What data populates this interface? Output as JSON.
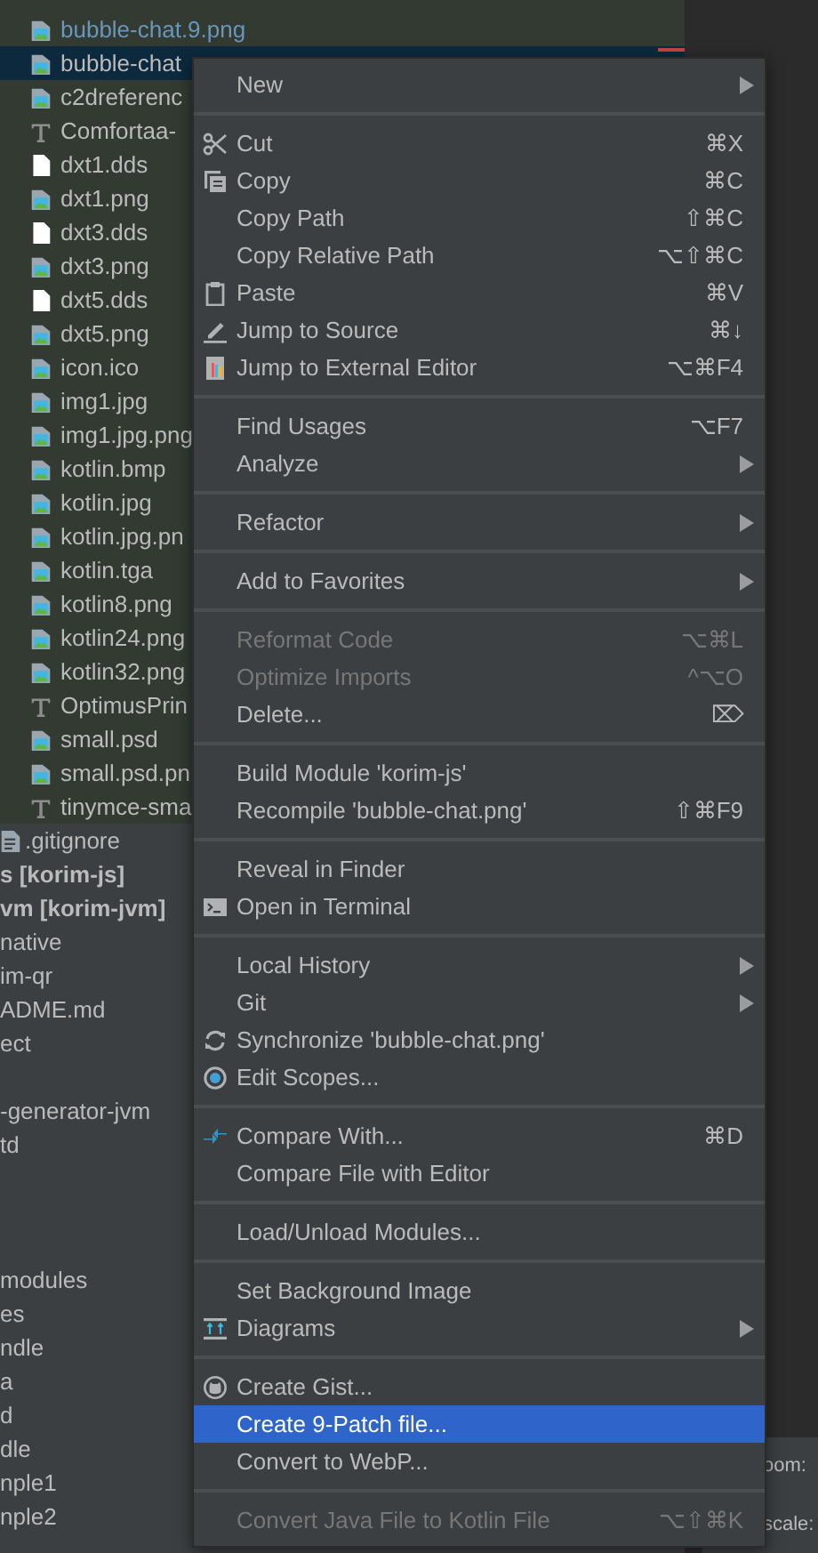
{
  "resource_files": [
    {
      "name": "bubble-chat.9.png",
      "kind": "image",
      "modified": true,
      "selected": false
    },
    {
      "name": "bubble-chat",
      "kind": "image",
      "modified": false,
      "selected": true
    },
    {
      "name": "c2dreferenc",
      "kind": "image",
      "modified": false,
      "selected": false
    },
    {
      "name": "Comfortaa-",
      "kind": "font",
      "modified": false,
      "selected": false
    },
    {
      "name": "dxt1.dds",
      "kind": "file",
      "modified": false,
      "selected": false
    },
    {
      "name": "dxt1.png",
      "kind": "image",
      "modified": false,
      "selected": false
    },
    {
      "name": "dxt3.dds",
      "kind": "file",
      "modified": false,
      "selected": false
    },
    {
      "name": "dxt3.png",
      "kind": "image",
      "modified": false,
      "selected": false
    },
    {
      "name": "dxt5.dds",
      "kind": "file",
      "modified": false,
      "selected": false
    },
    {
      "name": "dxt5.png",
      "kind": "image",
      "modified": false,
      "selected": false
    },
    {
      "name": "icon.ico",
      "kind": "image",
      "modified": false,
      "selected": false
    },
    {
      "name": "img1.jpg",
      "kind": "image",
      "modified": false,
      "selected": false
    },
    {
      "name": "img1.jpg.png",
      "kind": "image",
      "modified": false,
      "selected": false
    },
    {
      "name": "kotlin.bmp",
      "kind": "image",
      "modified": false,
      "selected": false
    },
    {
      "name": "kotlin.jpg",
      "kind": "image",
      "modified": false,
      "selected": false
    },
    {
      "name": "kotlin.jpg.pn",
      "kind": "image",
      "modified": false,
      "selected": false
    },
    {
      "name": "kotlin.tga",
      "kind": "image",
      "modified": false,
      "selected": false
    },
    {
      "name": "kotlin8.png",
      "kind": "image",
      "modified": false,
      "selected": false
    },
    {
      "name": "kotlin24.png",
      "kind": "image",
      "modified": false,
      "selected": false
    },
    {
      "name": "kotlin32.png",
      "kind": "image",
      "modified": false,
      "selected": false
    },
    {
      "name": "OptimusPrin",
      "kind": "font",
      "modified": false,
      "selected": false
    },
    {
      "name": "small.psd",
      "kind": "image",
      "modified": false,
      "selected": false
    },
    {
      "name": "small.psd.pn",
      "kind": "image",
      "modified": false,
      "selected": false
    },
    {
      "name": "tinymce-sma",
      "kind": "font",
      "modified": false,
      "selected": false
    }
  ],
  "project_tree": [
    {
      "items": [
        {
          "name": ".gitignore",
          "kind": "text",
          "bold": false
        },
        {
          "name": "s [korim-js]",
          "kind": "plain",
          "bold": true
        },
        {
          "name": "vm [korim-jvm]",
          "kind": "plain",
          "bold": true
        },
        {
          "name": "native",
          "kind": "plain",
          "bold": false
        },
        {
          "name": "im-qr",
          "kind": "plain",
          "bold": false
        },
        {
          "name": "ADME.md",
          "kind": "plain",
          "bold": false
        },
        {
          "name": "ect",
          "kind": "plain",
          "bold": false
        }
      ]
    },
    {
      "items": [
        {
          "name": "-generator-jvm",
          "kind": "plain",
          "bold": false
        },
        {
          "name": "td",
          "kind": "plain",
          "bold": false
        }
      ]
    },
    {
      "items": [
        {
          "name": "modules",
          "kind": "plain",
          "bold": false
        },
        {
          "name": "es",
          "kind": "plain",
          "bold": false
        },
        {
          "name": "ndle",
          "kind": "plain",
          "bold": false
        },
        {
          "name": "a",
          "kind": "plain",
          "bold": false
        },
        {
          "name": "d",
          "kind": "plain",
          "bold": false
        },
        {
          "name": "dle",
          "kind": "plain",
          "bold": false
        },
        {
          "name": "nple1",
          "kind": "plain",
          "bold": false
        },
        {
          "name": "nple2",
          "kind": "plain",
          "bold": false
        }
      ]
    }
  ],
  "side_panel": [
    "oom:",
    "scale:"
  ],
  "context_menu": [
    [
      {
        "label": "New",
        "submenu": true,
        "disabled": false,
        "selected": false
      }
    ],
    [
      {
        "label": "Cut",
        "kind": "scissors",
        "shortcut": "⌘X",
        "submenu": false,
        "disabled": false,
        "selected": false
      },
      {
        "label": "Copy",
        "kind": "copy",
        "shortcut": "⌘C",
        "submenu": false,
        "disabled": false,
        "selected": false
      },
      {
        "label": "Copy Path",
        "shortcut": "⇧⌘C",
        "submenu": false,
        "disabled": false,
        "selected": false
      },
      {
        "label": "Copy Relative Path",
        "shortcut": "⌥⇧⌘C",
        "submenu": false,
        "disabled": false,
        "selected": false
      },
      {
        "label": "Paste",
        "kind": "clipboard",
        "shortcut": "⌘V",
        "submenu": false,
        "disabled": false,
        "selected": false
      },
      {
        "label": "Jump to Source",
        "kind": "pencil",
        "shortcut": "⌘↓",
        "submenu": false,
        "disabled": false,
        "selected": false
      },
      {
        "label": "Jump to External Editor",
        "kind": "external",
        "shortcut": "⌥⌘F4",
        "submenu": false,
        "disabled": false,
        "selected": false
      }
    ],
    [
      {
        "label": "Find Usages",
        "shortcut": "⌥F7",
        "submenu": false,
        "disabled": false,
        "selected": false
      },
      {
        "label": "Analyze",
        "submenu": true,
        "disabled": false,
        "selected": false
      }
    ],
    [
      {
        "label": "Refactor",
        "submenu": true,
        "disabled": false,
        "selected": false
      }
    ],
    [
      {
        "label": "Add to Favorites",
        "submenu": true,
        "disabled": false,
        "selected": false
      }
    ],
    [
      {
        "label": "Reformat Code",
        "shortcut": "⌥⌘L",
        "submenu": false,
        "disabled": true,
        "selected": false
      },
      {
        "label": "Optimize Imports",
        "shortcut": "^⌥O",
        "submenu": false,
        "disabled": true,
        "selected": false
      },
      {
        "label": "Delete...",
        "shortcut": "⌦",
        "submenu": false,
        "disabled": false,
        "selected": false
      }
    ],
    [
      {
        "label": "Build Module 'korim-js'",
        "submenu": false,
        "disabled": false,
        "selected": false
      },
      {
        "label": "Recompile 'bubble-chat.png'",
        "shortcut": "⇧⌘F9",
        "submenu": false,
        "disabled": false,
        "selected": false
      }
    ],
    [
      {
        "label": "Reveal in Finder",
        "submenu": false,
        "disabled": false,
        "selected": false
      },
      {
        "label": "Open in Terminal",
        "kind": "terminal",
        "submenu": false,
        "disabled": false,
        "selected": false
      }
    ],
    [
      {
        "label": "Local History",
        "submenu": true,
        "disabled": false,
        "selected": false
      },
      {
        "label": "Git",
        "submenu": true,
        "disabled": false,
        "selected": false
      },
      {
        "label": "Synchronize 'bubble-chat.png'",
        "kind": "sync",
        "submenu": false,
        "disabled": false,
        "selected": false
      },
      {
        "label": "Edit Scopes...",
        "kind": "scope",
        "submenu": false,
        "disabled": false,
        "selected": false
      }
    ],
    [
      {
        "label": "Compare With...",
        "kind": "compare",
        "shortcut": "⌘D",
        "submenu": false,
        "disabled": false,
        "selected": false
      },
      {
        "label": "Compare File with Editor",
        "submenu": false,
        "disabled": false,
        "selected": false
      }
    ],
    [
      {
        "label": "Load/Unload Modules...",
        "submenu": false,
        "disabled": false,
        "selected": false
      }
    ],
    [
      {
        "label": "Set Background Image",
        "submenu": false,
        "disabled": false,
        "selected": false
      },
      {
        "label": "Diagrams",
        "kind": "diagram",
        "submenu": true,
        "disabled": false,
        "selected": false
      }
    ],
    [
      {
        "label": "Create Gist...",
        "kind": "github",
        "submenu": false,
        "disabled": false,
        "selected": false
      },
      {
        "label": "Create 9-Patch file...",
        "submenu": false,
        "disabled": false,
        "selected": true
      },
      {
        "label": "Convert to WebP...",
        "submenu": false,
        "disabled": false,
        "selected": false
      }
    ],
    [
      {
        "label": "Convert Java File to Kotlin File",
        "shortcut": "⌥⇧⌘K",
        "submenu": false,
        "disabled": true,
        "selected": false
      }
    ]
  ]
}
